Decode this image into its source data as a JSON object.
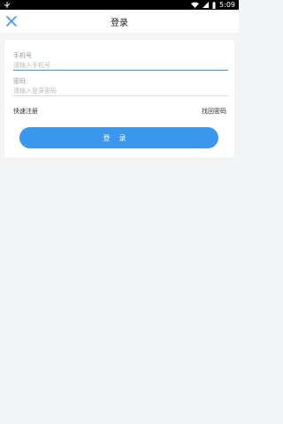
{
  "status_bar": {
    "time": "5:09",
    "icons": [
      "usb-icon",
      "wifi-icon",
      "signal-icon",
      "battery-icon"
    ]
  },
  "header": {
    "title": "登录",
    "close_icon": "close-icon"
  },
  "form": {
    "phone_label": "手机号",
    "phone_placeholder": "请输入手机号",
    "password_label": "密码",
    "password_placeholder": "请输入登录密码",
    "register_link": "快速注册",
    "forgot_link": "找回密码",
    "login_button": "登录"
  },
  "colors": {
    "accent": "#3a97ee",
    "background": "#f3f4f6",
    "card": "#ffffff"
  }
}
